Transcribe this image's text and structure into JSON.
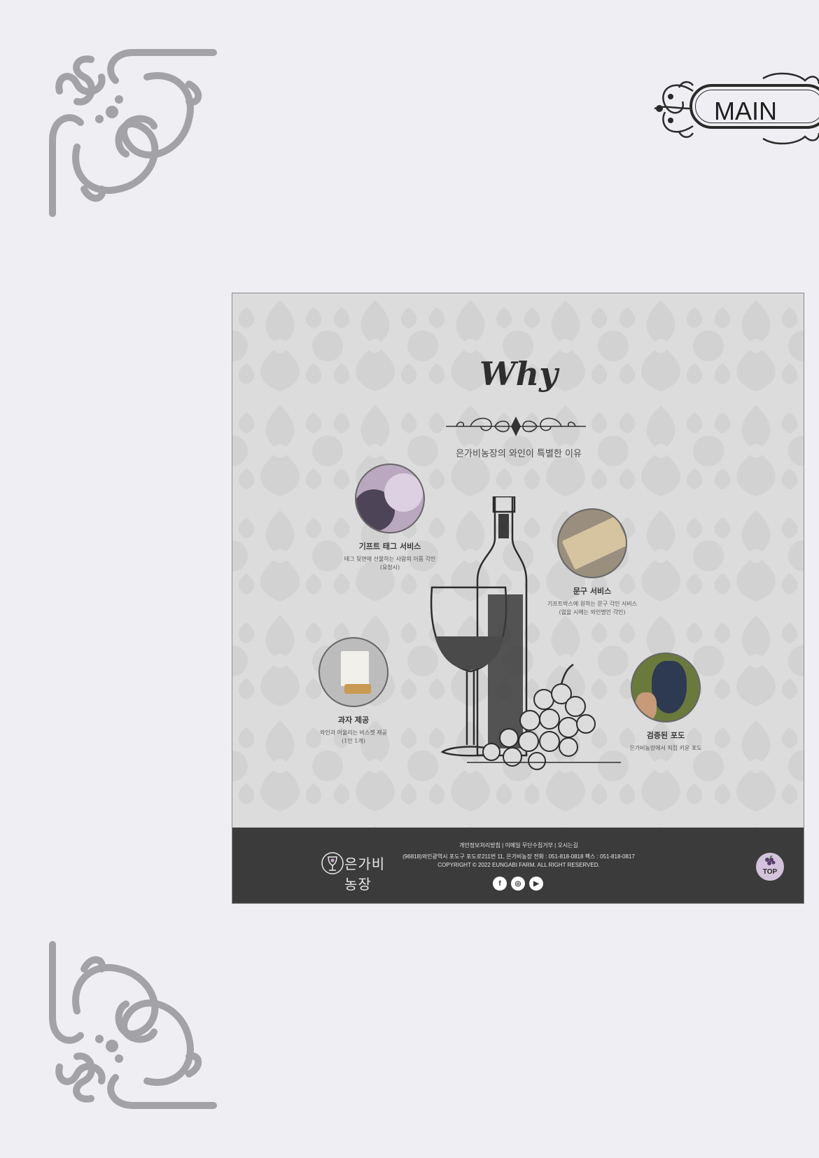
{
  "header": {
    "banner_label": "MAIN"
  },
  "why": {
    "title": "Why",
    "subtitle": "은가비농장의 와인이 특별한 이유"
  },
  "features": [
    {
      "title": "기프트 태그 서비스",
      "desc1": "태그 뒷면에 선물하는 사람의 이름 각인",
      "desc2": "(요청시)"
    },
    {
      "title": "문구 서비스",
      "desc1": "기프트박스에 원하는 문구 각인 서비스",
      "desc2": "(없을 시에는 와인명인 각인)"
    },
    {
      "title": "과자 제공",
      "desc1": "와인과 어울리는 비스켓 제공",
      "desc2": "(1인 1개)"
    },
    {
      "title": "검증된 포도",
      "desc1": "은가비농장에서 직접 키운 포도",
      "desc2": ""
    }
  ],
  "footer": {
    "logo_text": "은가비농장",
    "links": "개인정보처리방침  |  이메일 무단수집거부  |  오시는길",
    "address": "(96818)와인광역시 포도구 포도로211번 11, 은가비농장   전화 : 051-818-0818  팩스 : 051-818-0817",
    "copyright": "COPYRIGHT © 2022 EUNGABI FARM. ALL RIGHT RESERVED.",
    "social": [
      "f",
      "◎",
      "▶"
    ],
    "top_label": "TOP"
  },
  "colors": {
    "background": "#efeef3",
    "ornament": "#a3a2a7",
    "footer_bg": "#3a3b3a",
    "top_button": "#d4c2dc"
  },
  "icons": [
    "corner-ornament-icon",
    "scroll-divider-icon",
    "wine-bottle-icon",
    "facebook-icon",
    "instagram-icon",
    "youtube-icon",
    "grape-icon"
  ]
}
